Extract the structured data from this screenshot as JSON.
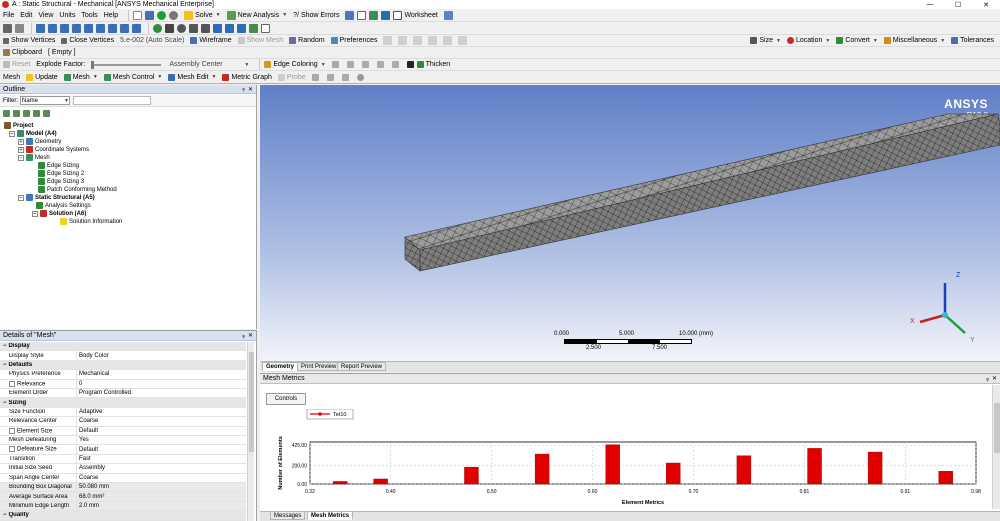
{
  "window": {
    "title": "A : Static Structural - Mechanical [ANSYS Mechanical Enterprise]",
    "minimize": "—",
    "maximize": "☐",
    "close": "✕"
  },
  "menu": [
    "File",
    "Edit",
    "View",
    "Units",
    "Tools",
    "Help"
  ],
  "toolbar1": {
    "solve": "Solve",
    "new_analysis": "New Analysis",
    "show_errors": "?/ Show Errors",
    "worksheet": "Worksheet"
  },
  "toolbar3": {
    "show_vertices": "Show Vertices",
    "close_vertices": "Close Vertices",
    "auto_scale": "5.e-002 (Auto Scale)",
    "wireframe": "Wireframe",
    "show_mesh": "Show Mesh",
    "random": "Random",
    "preferences": "Preferences",
    "size": "Size",
    "location": "Location",
    "convert": "Convert",
    "miscellaneous": "Miscellaneous",
    "tolerances": "Tolerances"
  },
  "toolbar4": {
    "clipboard": "Clipboard",
    "empty": "[ Empty ]"
  },
  "toolbar5": {
    "reset": "Reset",
    "explode_factor": "Explode Factor:",
    "assembly_center": "Assembly Center",
    "edge_coloring": "Edge Coloring",
    "thicken": "Thicken"
  },
  "toolbar6": {
    "mesh": "Mesh",
    "update": "Update",
    "mesh_dd": "Mesh",
    "mesh_control": "Mesh Control",
    "mesh_edit": "Mesh Edit",
    "metric_graph": "Metric Graph",
    "probe": "Probe"
  },
  "outline": {
    "title": "Outline",
    "filter_label": "Filter:",
    "filter_value": "Name",
    "items": [
      {
        "label": "Project",
        "bold": true
      },
      {
        "label": "Model (A4)",
        "bold": true
      },
      {
        "label": "Geometry",
        "bold": false
      },
      {
        "label": "Coordinate Systems",
        "bold": false
      },
      {
        "label": "Mesh",
        "bold": false
      },
      {
        "label": "Edge Sizing",
        "bold": false
      },
      {
        "label": "Edge Sizing 2",
        "bold": false
      },
      {
        "label": "Edge Sizing 3",
        "bold": false
      },
      {
        "label": "Patch Conforming Method",
        "bold": false
      },
      {
        "label": "Static Structural (A5)",
        "bold": true
      },
      {
        "label": "Analysis Settings",
        "bold": false
      },
      {
        "label": "Solution (A6)",
        "bold": true
      },
      {
        "label": "Solution Information",
        "bold": false
      }
    ]
  },
  "details": {
    "title": "Details of \"Mesh\"",
    "rows": [
      {
        "k": "Display",
        "v": "",
        "sec": true
      },
      {
        "k": "Display Style",
        "v": "Body Color"
      },
      {
        "k": "Defaults",
        "v": "",
        "sec": true
      },
      {
        "k": "Physics Preference",
        "v": "Mechanical"
      },
      {
        "k": "Relevance",
        "v": "0",
        "cb": true
      },
      {
        "k": "Element Order",
        "v": "Program Controlled"
      },
      {
        "k": "Sizing",
        "v": "",
        "sec": true
      },
      {
        "k": "Size Function",
        "v": "Adaptive"
      },
      {
        "k": "Relevance Center",
        "v": "Coarse"
      },
      {
        "k": "Element Size",
        "v": "Default",
        "cb": true
      },
      {
        "k": "Mesh Defeaturing",
        "v": "Yes"
      },
      {
        "k": "Defeature Size",
        "v": "Default",
        "cb": true
      },
      {
        "k": "Transition",
        "v": "Fast"
      },
      {
        "k": "Initial Size Seed",
        "v": "Assembly"
      },
      {
        "k": "Span Angle Center",
        "v": "Coarse"
      },
      {
        "k": "Bounding Box Diagonal",
        "v": "50.080 mm",
        "gray": true
      },
      {
        "k": "Average Surface Area",
        "v": "68.0 mm²",
        "gray": true
      },
      {
        "k": "Minimum Edge Length",
        "v": "2.0 mm",
        "gray": true
      },
      {
        "k": "Quality",
        "v": "",
        "sec": true
      }
    ]
  },
  "viewport": {
    "logo": "ANSYS",
    "version": "R19.0",
    "scale_top": [
      "0.000",
      "5.000",
      "10.000 (mm)"
    ],
    "scale_bottom": [
      "2.500",
      "7.500"
    ],
    "axis_z": "Z",
    "axis_x": "X",
    "axis_y": "Y"
  },
  "view_tabs": [
    "Geometry",
    "Print Preview",
    "Report Preview"
  ],
  "metrics": {
    "title": "Mesh Metrics",
    "controls": "Controls",
    "legend": "Tet10",
    "ylabel": "Number of Elements",
    "xlabel": "Element Metrics",
    "bottom_tabs": [
      "Messages",
      "Mesh Metrics"
    ]
  },
  "chart_data": {
    "type": "bar",
    "series": [
      {
        "name": "Tet10"
      }
    ],
    "x": [
      0.35,
      0.39,
      0.48,
      0.55,
      0.62,
      0.68,
      0.75,
      0.82,
      0.88,
      0.95
    ],
    "values": [
      28,
      55,
      185,
      328,
      430,
      230,
      310,
      390,
      350,
      140
    ],
    "xticks": [
      "0.32",
      "0.40",
      "0.50",
      "0.60",
      "0.70",
      "0.81",
      "0.91",
      "0.98"
    ],
    "xtick_values": [
      0.32,
      0.4,
      0.5,
      0.6,
      0.7,
      0.81,
      0.91,
      0.98
    ],
    "yticks": [
      "0.00",
      "200.00",
      "425.00"
    ],
    "ytick_values": [
      0,
      200,
      425
    ],
    "xlim": [
      0.32,
      0.98
    ],
    "ylim": [
      0,
      460
    ],
    "color": "#e00000"
  },
  "colors": {
    "viewport_top": "#5f7fc7",
    "viewport_bottom": "#f2f4fa",
    "panel_header": "#d9e1ee",
    "bar": "#e00000"
  }
}
